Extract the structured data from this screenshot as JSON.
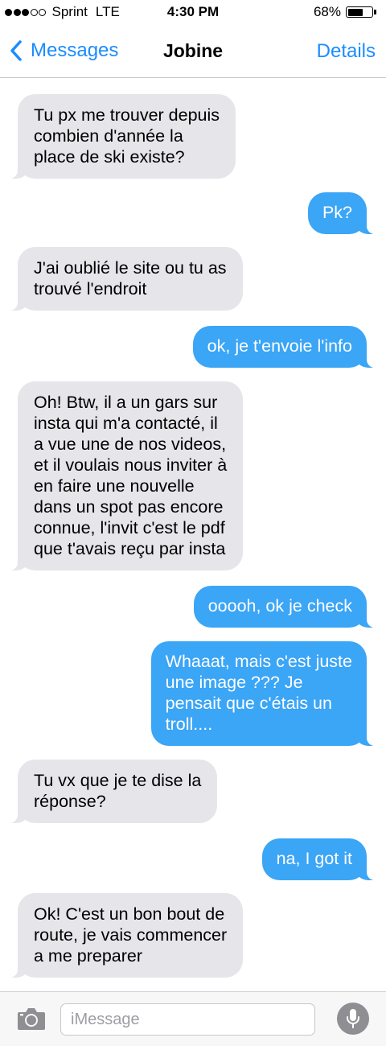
{
  "status_bar": {
    "carrier": "Sprint",
    "network": "LTE",
    "time": "4:30 PM",
    "battery": "68%",
    "battery_level": 0.68,
    "signal_bars_filled": 3,
    "signal_bars_total": 5
  },
  "nav": {
    "back_label": "Messages",
    "title": "Jobine",
    "details_label": "Details"
  },
  "messages": [
    {
      "side": "in",
      "text": "Tu px me trouver depuis\ncombien d'année la\nplace de ski existe?"
    },
    {
      "side": "out",
      "text": "Pk?"
    },
    {
      "side": "in",
      "text": "J'ai oublié le site ou tu as\ntrouvé l'endroit"
    },
    {
      "side": "out",
      "text": "ok, je t'envoie l'info"
    },
    {
      "side": "in",
      "text": "Oh! Btw, il a un gars sur\ninsta qui m'a contacté, il\na vue une de nos videos,\net il voulais nous inviter à\nen faire une nouvelle\ndans un spot pas encore\nconnue, l'invit c'est le pdf\nque t'avais reçu par insta"
    },
    {
      "side": "out",
      "text": "ooooh, ok je check"
    },
    {
      "side": "out",
      "text": "Whaaat, mais c'est juste\nune image ??? Je\npensait que c'étais un\ntroll...."
    },
    {
      "side": "in",
      "text": "Tu vx que je te dise la\nréponse?"
    },
    {
      "side": "out",
      "text": "na, I got it"
    },
    {
      "side": "in",
      "text": "Ok! C'est un bon bout de\nroute, je vais commencer\na me preparer"
    }
  ],
  "input": {
    "placeholder": "iMessage"
  },
  "colors": {
    "accent": "#1a8cff",
    "outgoing_bubble": "#3ba5f6",
    "incoming_bubble": "#e5e5ea"
  },
  "icons": {
    "back": "chevron-left-icon",
    "camera": "camera-icon",
    "mic": "microphone-icon"
  }
}
